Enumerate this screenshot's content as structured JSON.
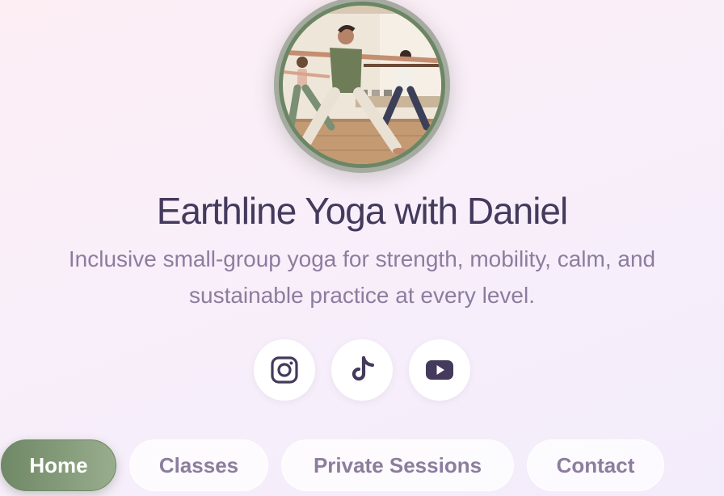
{
  "colors": {
    "accent": "#6f8866",
    "title": "#433a5c",
    "muted": "#8c7d9e",
    "icon": "#433a5c"
  },
  "profile": {
    "avatar_alt": "yoga-class-photo",
    "title": "Earthline Yoga with Daniel",
    "tagline": "Inclusive small-group yoga for strength, mobility, calm, and sustainable practice at every level."
  },
  "socials": [
    {
      "name": "instagram-icon"
    },
    {
      "name": "tiktok-icon"
    },
    {
      "name": "youtube-icon"
    }
  ],
  "nav": {
    "items": [
      {
        "label": "Home",
        "active": true
      },
      {
        "label": "Classes",
        "active": false
      },
      {
        "label": "Private Sessions",
        "active": false
      },
      {
        "label": "Contact",
        "active": false
      }
    ]
  }
}
